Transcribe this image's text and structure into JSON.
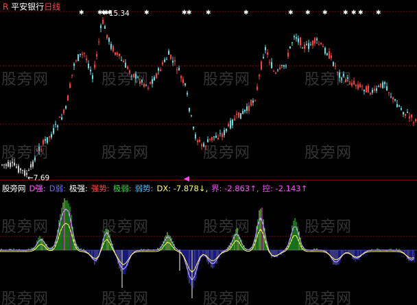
{
  "title": {
    "prefix": "R",
    "stock": "平安银行",
    "period": "日线"
  },
  "price_labels": {
    "high": "←15.34",
    "low": "←7.69"
  },
  "indicator_legend": [
    {
      "text": "股旁网",
      "color": "#ffffff"
    },
    {
      "text": "D强:",
      "color": "#ff60ff"
    },
    {
      "text": "D弱:",
      "color": "#6a6aff"
    },
    {
      "text": "极强:",
      "color": "#ffffff"
    },
    {
      "text": "强势:",
      "color": "#ff4040"
    },
    {
      "text": "极弱:",
      "color": "#30e030"
    },
    {
      "text": "弱势:",
      "color": "#40c0ff"
    },
    {
      "text": "DX: -7.878↓,",
      "color": "#ffff60"
    },
    {
      "text": "界: -2.863↑,",
      "color": "#ff50ff"
    },
    {
      "text": "控: -2.143↑",
      "color": "#ff50ff"
    }
  ],
  "watermark": "股旁网",
  "colors": {
    "up": "#ff3c3c",
    "down": "#5fe0e0",
    "grid": "#8a0000",
    "star": "#ffffff",
    "marker": "#ff40ff"
  }
}
